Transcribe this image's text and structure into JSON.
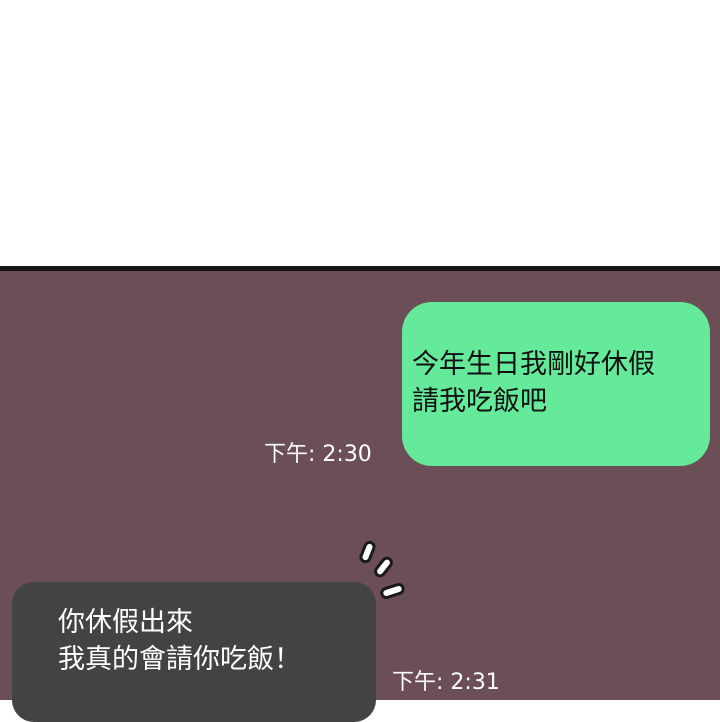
{
  "messages": [
    {
      "direction": "outgoing",
      "text": "今年生日我剛好休假\n請我吃飯吧",
      "time": "下午: 2:30"
    },
    {
      "direction": "incoming",
      "text": "你休假出來\n我真的會請你吃飯！",
      "time": "下午: 2:31"
    }
  ],
  "colors": {
    "chat_background": "#6c4e56",
    "outgoing_bubble": "#65e99b",
    "incoming_bubble": "#434346",
    "divider": "#151515"
  },
  "decorations": {
    "sfx_icon": "surprise-lines-icon"
  }
}
